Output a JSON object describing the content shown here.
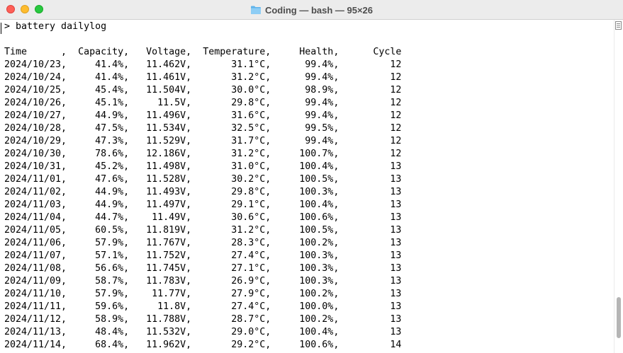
{
  "window": {
    "title": "Coding — bash — 95×26",
    "icon": "folder-icon"
  },
  "terminal": {
    "prompt": "> ",
    "command": "battery dailylog",
    "header": "Time      ,  Capacity,   Voltage,  Temperature,     Health,      Cycle",
    "rows": [
      "2024/10/23,     41.4%,   11.462V,       31.1°C,      99.4%,         12",
      "2024/10/24,     41.4%,   11.461V,       31.2°C,      99.4%,         12",
      "2024/10/25,     45.4%,   11.504V,       30.0°C,      98.9%,         12",
      "2024/10/26,     45.1%,     11.5V,       29.8°C,      99.4%,         12",
      "2024/10/27,     44.9%,   11.496V,       31.6°C,      99.4%,         12",
      "2024/10/28,     47.5%,   11.534V,       32.5°C,      99.5%,         12",
      "2024/10/29,     47.3%,   11.529V,       31.7°C,      99.4%,         12",
      "2024/10/30,     78.6%,   12.186V,       31.2°C,     100.7%,         12",
      "2024/10/31,     45.2%,   11.498V,       31.0°C,     100.4%,         13",
      "2024/11/01,     47.6%,   11.528V,       30.2°C,     100.5%,         13",
      "2024/11/02,     44.9%,   11.493V,       29.8°C,     100.3%,         13",
      "2024/11/03,     44.9%,   11.497V,       29.1°C,     100.4%,         13",
      "2024/11/04,     44.7%,    11.49V,       30.6°C,     100.6%,         13",
      "2024/11/05,     60.5%,   11.819V,       31.2°C,     100.5%,         13",
      "2024/11/06,     57.9%,   11.767V,       28.3°C,     100.2%,         13",
      "2024/11/07,     57.1%,   11.752V,       27.4°C,     100.3%,         13",
      "2024/11/08,     56.6%,   11.745V,       27.1°C,     100.3%,         13",
      "2024/11/09,     58.7%,   11.783V,       26.9°C,     100.3%,         13",
      "2024/11/10,     57.9%,    11.77V,       27.9°C,     100.2%,         13",
      "2024/11/11,     59.6%,     11.8V,       27.4°C,     100.0%,         13",
      "2024/11/12,     58.9%,   11.788V,       28.7°C,     100.2%,         13",
      "2024/11/13,     48.4%,   11.532V,       29.0°C,     100.4%,         13",
      "2024/11/14,     68.4%,   11.962V,       29.2°C,     100.6%,         14"
    ]
  },
  "colors": {
    "close": "#fe5f57",
    "minimize": "#febc2e",
    "maximize": "#28c840",
    "titlebar": "#ececec",
    "text": "#000000"
  }
}
